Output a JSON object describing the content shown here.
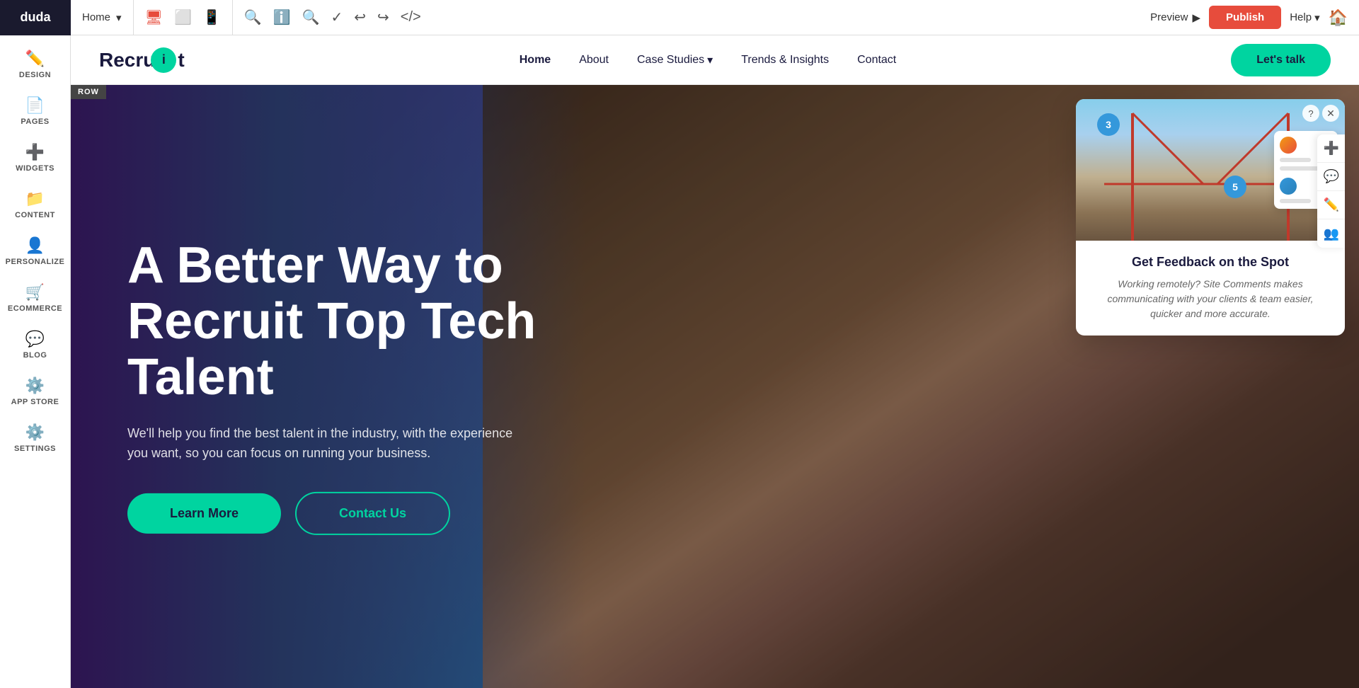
{
  "toolbar": {
    "logo": "duda",
    "page_selector": "Home",
    "chevron": "▾",
    "preview_label": "Preview",
    "publish_label": "Publish",
    "help_label": "Help"
  },
  "sidebar": {
    "items": [
      {
        "id": "design",
        "icon": "✏️",
        "label": "DESIGN"
      },
      {
        "id": "pages",
        "icon": "📄",
        "label": "PAGES"
      },
      {
        "id": "widgets",
        "icon": "➕",
        "label": "WIDGETS"
      },
      {
        "id": "content",
        "icon": "📁",
        "label": "CONTENT"
      },
      {
        "id": "personalize",
        "icon": "👤",
        "label": "PERSONALIZE"
      },
      {
        "id": "ecommerce",
        "icon": "🛒",
        "label": "ECOMMERCE"
      },
      {
        "id": "blog",
        "icon": "💬",
        "label": "BLOG"
      },
      {
        "id": "appstore",
        "icon": "⚙️",
        "label": "APP STORE"
      },
      {
        "id": "settings",
        "icon": "⚙️",
        "label": "SETTINGS"
      }
    ]
  },
  "site": {
    "logo_text_start": "Recru",
    "logo_text_end": "t",
    "logo_dot": "i",
    "nav": [
      {
        "id": "home",
        "label": "Home",
        "active": true
      },
      {
        "id": "about",
        "label": "About"
      },
      {
        "id": "case-studies",
        "label": "Case Studies",
        "hasDropdown": true
      },
      {
        "id": "trends",
        "label": "Trends & Insights"
      },
      {
        "id": "contact",
        "label": "Contact"
      }
    ],
    "cta_label": "Let's talk"
  },
  "hero": {
    "row_badge": "ROW",
    "title_line1": "A Better Way to",
    "title_line2": "Recruit Top Tech",
    "title_line3": "Talent",
    "subtitle": "We'll help you find the best talent in the industry, with the experience you want, so you can focus on running your business.",
    "btn_learn_more": "Learn More",
    "btn_contact_us": "Contact Us"
  },
  "popup": {
    "badge_3": "3",
    "badge_5": "5",
    "title": "Get Feedback on the Spot",
    "description": "Working remotely? Site Comments makes communicating with your clients & team easier, quicker and more accurate."
  }
}
